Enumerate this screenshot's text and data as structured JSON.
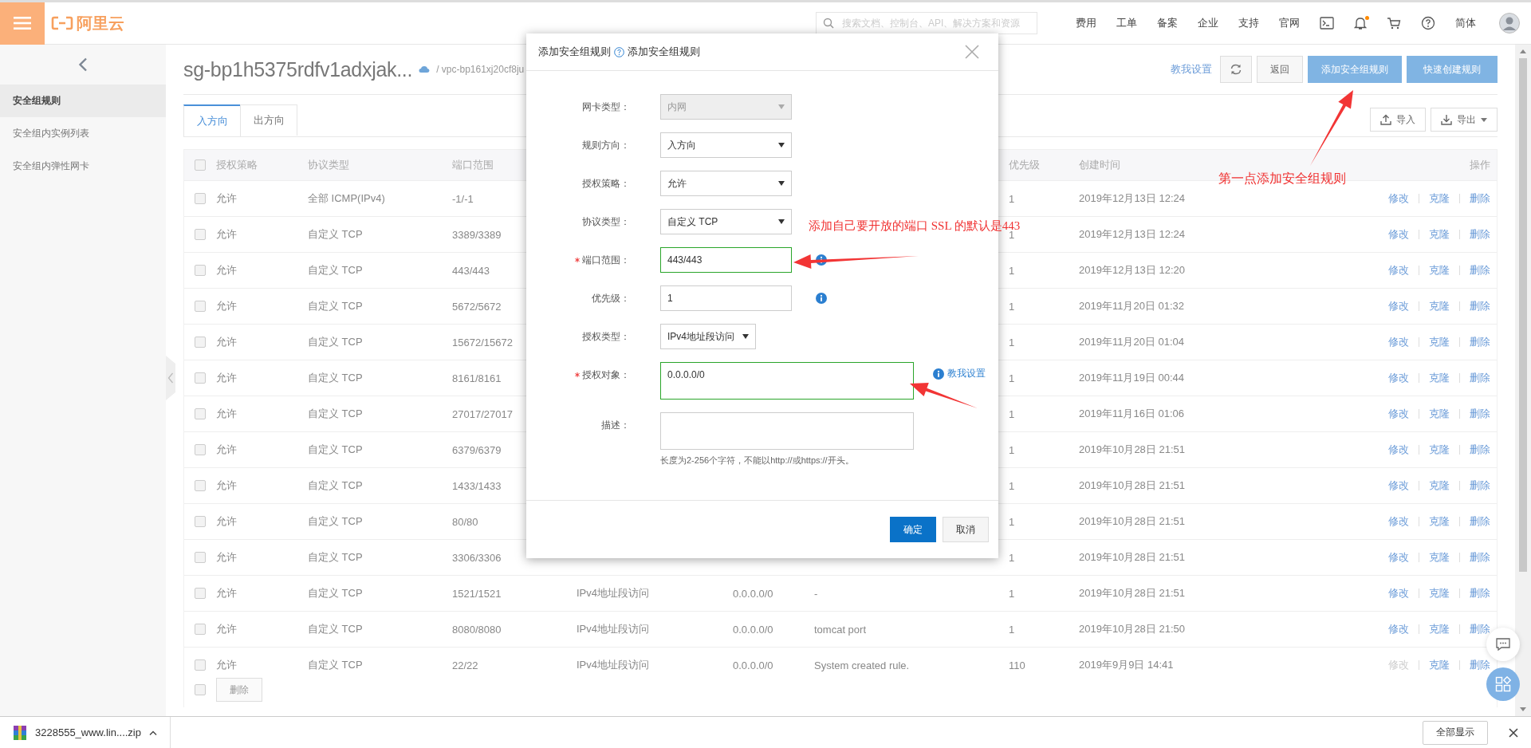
{
  "top_bar": {
    "logo": "阿里云",
    "search": {
      "placeholder": "搜索文档、控制台、API、解决方案和资源"
    },
    "nav": [
      "费用",
      "工单",
      "备案",
      "企业",
      "支持",
      "官网"
    ],
    "notifications": true,
    "language": "简体"
  },
  "sidebar": {
    "items": [
      {
        "label": "安全组规则",
        "selected": true
      },
      {
        "label": "安全组内实例列表",
        "selected": false
      },
      {
        "label": "安全组内弹性网卡",
        "selected": false
      }
    ]
  },
  "page": {
    "title": "sg-bp1h5375rdfv1adxjak...",
    "vpc": "/ vpc-bp161xj20cf8ju",
    "help_link": "教我设置",
    "buttons": [
      {
        "label": "返回",
        "kind": "default"
      },
      {
        "label": "添加安全组规则",
        "kind": "primary"
      },
      {
        "label": "快速创建规则",
        "kind": "primary"
      }
    ]
  },
  "tabs": [
    {
      "label": "入方向",
      "selected": true
    },
    {
      "label": "出方向",
      "selected": false
    }
  ],
  "table_tools": [
    {
      "label": "导入",
      "kind": "import"
    },
    {
      "label": "导出",
      "kind": "export"
    }
  ],
  "table": {
    "checked": false,
    "columns": [
      "授权策略",
      "协议类型",
      "端口范围",
      "优先级",
      "创建时间",
      "操作"
    ],
    "rows": [
      {
        "checked": false,
        "policy": "允许",
        "protocol": "全部 ICMP(IPv4)",
        "port": "-1/-1",
        "priority": "1",
        "created": "2019年12月13日 12:24",
        "actions": [
          {
            "label": "修改",
            "disabled": false
          },
          {
            "label": "克隆",
            "disabled": false
          },
          {
            "label": "删除",
            "disabled": false
          }
        ]
      },
      {
        "checked": false,
        "policy": "允许",
        "protocol": "自定义 TCP",
        "port": "3389/3389",
        "priority": "1",
        "created": "2019年12月13日 12:24",
        "actions": [
          {
            "label": "修改",
            "disabled": false
          },
          {
            "label": "克隆",
            "disabled": false
          },
          {
            "label": "删除",
            "disabled": false
          }
        ]
      },
      {
        "checked": false,
        "policy": "允许",
        "protocol": "自定义 TCP",
        "port": "443/443",
        "priority": "1",
        "created": "2019年12月13日 12:20",
        "actions": [
          {
            "label": "修改",
            "disabled": false
          },
          {
            "label": "克隆",
            "disabled": false
          },
          {
            "label": "删除",
            "disabled": false
          }
        ]
      },
      {
        "checked": false,
        "policy": "允许",
        "protocol": "自定义 TCP",
        "port": "5672/5672",
        "priority": "1",
        "created": "2019年11月20日 01:32",
        "actions": [
          {
            "label": "修改",
            "disabled": false
          },
          {
            "label": "克隆",
            "disabled": false
          },
          {
            "label": "删除",
            "disabled": false
          }
        ]
      },
      {
        "checked": false,
        "policy": "允许",
        "protocol": "自定义 TCP",
        "port": "15672/15672",
        "priority": "1",
        "created": "2019年11月20日 01:04",
        "actions": [
          {
            "label": "修改",
            "disabled": false
          },
          {
            "label": "克隆",
            "disabled": false
          },
          {
            "label": "删除",
            "disabled": false
          }
        ]
      },
      {
        "checked": false,
        "policy": "允许",
        "protocol": "自定义 TCP",
        "port": "8161/8161",
        "priority": "1",
        "created": "2019年11月19日 00:44",
        "actions": [
          {
            "label": "修改",
            "disabled": false
          },
          {
            "label": "克隆",
            "disabled": false
          },
          {
            "label": "删除",
            "disabled": false
          }
        ]
      },
      {
        "checked": false,
        "policy": "允许",
        "protocol": "自定义 TCP",
        "port": "27017/27017",
        "priority": "1",
        "created": "2019年11月16日 01:06",
        "actions": [
          {
            "label": "修改",
            "disabled": false
          },
          {
            "label": "克隆",
            "disabled": false
          },
          {
            "label": "删除",
            "disabled": false
          }
        ]
      },
      {
        "checked": false,
        "policy": "允许",
        "protocol": "自定义 TCP",
        "port": "6379/6379",
        "priority": "1",
        "created": "2019年10月28日 21:51",
        "actions": [
          {
            "label": "修改",
            "disabled": false
          },
          {
            "label": "克隆",
            "disabled": false
          },
          {
            "label": "删除",
            "disabled": false
          }
        ]
      },
      {
        "checked": false,
        "policy": "允许",
        "protocol": "自定义 TCP",
        "port": "1433/1433",
        "priority": "1",
        "created": "2019年10月28日 21:51",
        "actions": [
          {
            "label": "修改",
            "disabled": false
          },
          {
            "label": "克隆",
            "disabled": false
          },
          {
            "label": "删除",
            "disabled": false
          }
        ]
      },
      {
        "checked": false,
        "policy": "允许",
        "protocol": "自定义 TCP",
        "port": "80/80",
        "priority": "1",
        "created": "2019年10月28日 21:51",
        "actions": [
          {
            "label": "修改",
            "disabled": false
          },
          {
            "label": "克隆",
            "disabled": false
          },
          {
            "label": "删除",
            "disabled": false
          }
        ]
      },
      {
        "checked": false,
        "policy": "允许",
        "protocol": "自定义 TCP",
        "port": "3306/3306",
        "priority": "1",
        "created": "2019年10月28日 21:51",
        "actions": [
          {
            "label": "修改",
            "disabled": false
          },
          {
            "label": "克隆",
            "disabled": false
          },
          {
            "label": "删除",
            "disabled": false
          }
        ]
      },
      {
        "checked": false,
        "policy": "允许",
        "protocol": "自定义 TCP",
        "port": "1521/1521",
        "auth_type": "IPv4地址段访问",
        "auth_object": "0.0.0.0/0",
        "description": "-",
        "priority": "1",
        "created": "2019年10月28日 21:51",
        "actions": [
          {
            "label": "修改",
            "disabled": false
          },
          {
            "label": "克隆",
            "disabled": false
          },
          {
            "label": "删除",
            "disabled": false
          }
        ]
      },
      {
        "checked": false,
        "policy": "允许",
        "protocol": "自定义 TCP",
        "port": "8080/8080",
        "auth_type": "IPv4地址段访问",
        "auth_object": "0.0.0.0/0",
        "description": "tomcat port",
        "priority": "1",
        "created": "2019年10月28日 21:50",
        "actions": [
          {
            "label": "修改",
            "disabled": false
          },
          {
            "label": "克隆",
            "disabled": false
          },
          {
            "label": "删除",
            "disabled": false
          }
        ]
      },
      {
        "checked": false,
        "policy": "允许",
        "protocol": "自定义 TCP",
        "port": "22/22",
        "auth_type": "IPv4地址段访问",
        "auth_object": "0.0.0.0/0",
        "description": "System created rule.",
        "priority": "110",
        "created": "2019年9月9日 14:41",
        "actions": [
          {
            "label": "修改",
            "disabled": true
          },
          {
            "label": "克隆",
            "disabled": false
          },
          {
            "label": "删除",
            "disabled": false
          }
        ]
      }
    ],
    "footer": {
      "checked": false,
      "button": {
        "label": "删除",
        "disabled": true
      }
    }
  },
  "modal": {
    "title": "添加安全组规则",
    "help_text": "添加安全组规则",
    "fields": [
      {
        "label": "网卡类型：",
        "kind": "select",
        "value": "内网",
        "required": false,
        "disabled": true,
        "valid": false,
        "info": false
      },
      {
        "label": "规则方向：",
        "kind": "select",
        "value": "入方向",
        "required": false,
        "disabled": false,
        "valid": false,
        "info": false
      },
      {
        "label": "授权策略：",
        "kind": "select",
        "value": "允许",
        "required": false,
        "disabled": false,
        "valid": false,
        "info": false
      },
      {
        "label": "协议类型：",
        "kind": "select",
        "value": "自定义 TCP",
        "required": false,
        "disabled": false,
        "valid": false,
        "info": false
      },
      {
        "label": "端口范围：",
        "kind": "input",
        "value": "443/443",
        "required": true,
        "disabled": false,
        "valid": true,
        "info": true
      },
      {
        "label": "优先级：",
        "kind": "input",
        "value": "1",
        "required": false,
        "disabled": false,
        "valid": false,
        "info": true
      },
      {
        "label": "授权类型：",
        "kind": "short-select",
        "value": "IPv4地址段访问",
        "required": false,
        "disabled": false,
        "valid": false,
        "info": false
      },
      {
        "label": "授权对象：",
        "kind": "textarea",
        "value": "0.0.0.0/0",
        "required": true,
        "disabled": false,
        "valid": true,
        "info": false,
        "help_link": "教我设置"
      },
      {
        "label": "描述：",
        "kind": "textarea",
        "required": false,
        "disabled": false,
        "valid": false,
        "info": false,
        "hint": "长度为2-256个字符，不能以http://或https://开头。"
      }
    ],
    "buttons": [
      {
        "label": "确定",
        "kind": "primary"
      },
      {
        "label": "取消",
        "kind": "default"
      }
    ]
  },
  "annotations": [
    "第一点添加安全组规则",
    "添加自己要开放的端口 SSL 的默认是443"
  ],
  "download_bar": {
    "file": "3228555_www.lin....zip",
    "show_all": "全部显示"
  }
}
